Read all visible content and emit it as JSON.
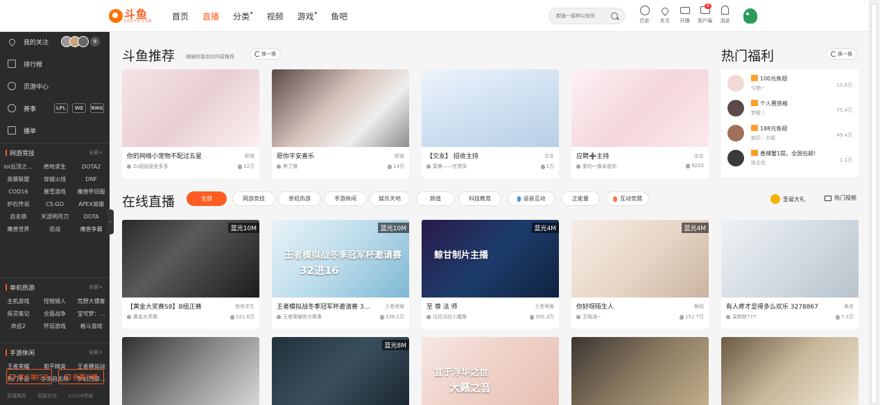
{
  "header": {
    "logo_cn": "斗鱼",
    "logo_en": "DOUYU.COM",
    "nav": [
      {
        "label": "首页",
        "active": false,
        "dropdown": false
      },
      {
        "label": "直播",
        "active": true,
        "dropdown": false
      },
      {
        "label": "分类",
        "active": false,
        "dropdown": true
      },
      {
        "label": "视频",
        "active": false,
        "dropdown": false
      },
      {
        "label": "游戏",
        "active": false,
        "dropdown": true
      },
      {
        "label": "鱼吧",
        "active": false,
        "dropdown": false
      }
    ],
    "search_placeholder": "颜值一姐林以安同",
    "tools": [
      {
        "label": "历史",
        "icon": "clock-icon"
      },
      {
        "label": "关注",
        "icon": "heart-icon"
      },
      {
        "label": "开播",
        "icon": "camera-icon"
      },
      {
        "label": "客户端",
        "icon": "desktop-icon",
        "badge": "8"
      },
      {
        "label": "消息",
        "icon": "bell-icon"
      }
    ]
  },
  "sidebar": {
    "main_items": [
      {
        "label": "我的关注",
        "icon": "heart-icon",
        "count": "9"
      },
      {
        "label": "排行榜",
        "icon": "ranking-icon"
      },
      {
        "label": "页游中心",
        "icon": "gamepad-icon"
      },
      {
        "label": "赛事",
        "icon": "trophy-icon"
      },
      {
        "label": "播单",
        "icon": "playlist-icon"
      }
    ],
    "team_logos": [
      "LPL",
      "WE",
      "RNG"
    ],
    "categories": [
      {
        "title": "网游竞技",
        "all": "全部+",
        "items": [
          "lol云顶之…",
          "绝地求生",
          "DOTA2",
          "英雄联盟",
          "穿越火线",
          "DNF",
          "COD16",
          "暴雪游戏",
          "魔兽怀旧服",
          "炉石传说",
          "CS:GO",
          "APEX英雄",
          "自走棋",
          "天涯明月刀",
          "DOTA",
          "魔兽世界",
          "逆战",
          "魔兽争霸"
        ]
      },
      {
        "title": "单机热游",
        "all": "全部+",
        "items": [
          "主机游戏",
          "怪物猎人",
          "荒野大镖客",
          "探灵笔记",
          "全面战争",
          "宝可梦：…",
          "命运2",
          "怀旧游戏",
          "格斗游戏"
        ]
      },
      {
        "title": "手游休闲",
        "all": "全部+",
        "items": [
          "王者荣耀",
          "和平精英",
          "王者模拟战",
          "热门手游",
          "多多自走棋",
          "梦幻西游…"
        ]
      }
    ],
    "btn_client": "客户端打开",
    "btn_live": "我要开播",
    "footer": [
      "直播推荐",
      "客服支持",
      "12318举报"
    ]
  },
  "recommend": {
    "title": "斗鱼推荐",
    "subtitle": "根据你喜欢的内容推荐",
    "refresh": "换一换",
    "cards": [
      {
        "title": "你的网络小宠物不配过五星",
        "category": "颜值",
        "owner": "Zz屈屈是金多多",
        "heat": "12万"
      },
      {
        "title": "愿你平安喜乐",
        "category": "颜值",
        "owner": "养了猪",
        "heat": "14万"
      },
      {
        "title": "【交友】 招收主持",
        "category": "交友",
        "owner": "富美——任惜深",
        "heat": "1万"
      },
      {
        "title": "应聘➕主持",
        "category": "交友",
        "owner": "爱的一像未是你",
        "heat": "9233"
      }
    ]
  },
  "welfare": {
    "title": "热门福利",
    "refresh": "换一换",
    "items": [
      {
        "title": "100元鱼翅",
        "user": "兮柚~",
        "heat": "15.8万"
      },
      {
        "title": "个人赛资格",
        "user": "梦醒丨",
        "heat": "75.4万"
      },
      {
        "title": "188元鱼翅",
        "user": "疯扔 - 大颖",
        "heat": "49.4万"
      },
      {
        "title": "香辣蟹1提。全国包邮!",
        "user": "牍主任",
        "heat": "1.1万"
      }
    ]
  },
  "live": {
    "title": "在线直播",
    "tabs": [
      "全部",
      "网游竞技",
      "单机热游",
      "手游休闲",
      "娱乐天地",
      "颜值",
      "科技教育",
      "语音互动",
      "正能量",
      "互动竞猜"
    ],
    "gift_link": "圣诞大礼",
    "video_link": "热门视频",
    "cards": [
      {
        "title": "【黄金大奖赛S8】B组正赛",
        "category": "绝地求生",
        "owner": "黄金大奖赛",
        "heat": "521.6万",
        "quality": "蓝光10M"
      },
      {
        "title": "王者模拟战冬季冠军杯邀请赛 3…",
        "category": "王者荣耀",
        "owner": "王者荣耀官方赛事",
        "heat": "138.1万",
        "quality": "蓝光10M",
        "overlay1": "王者模拟战冬季冠军杯邀请赛",
        "overlay2": "32进16"
      },
      {
        "title": "至 尊 法 师",
        "category": "王者荣耀",
        "owner": "马拉马拉小魔豫",
        "heat": "305.3万",
        "quality": "蓝光4M",
        "overlay1": "鲸甘制片主播"
      },
      {
        "title": "你好呀陌生人",
        "category": "舞蹈",
        "owner": "王晓沫~",
        "heat": "152.7万",
        "quality": "蓝光4M"
      },
      {
        "title": "有人疼才显得多么欢乐 3278867",
        "category": "美食",
        "owner": "呆默默777",
        "heat": "7.3万",
        "quality": ""
      }
    ],
    "row2": [
      {
        "quality": ""
      },
      {
        "quality": "蓝光8M"
      },
      {
        "quality": "",
        "overlay1": "宜于浮华之世",
        "overlay2": "大籁之音"
      },
      {
        "quality": ""
      },
      {
        "quality": ""
      }
    ]
  }
}
